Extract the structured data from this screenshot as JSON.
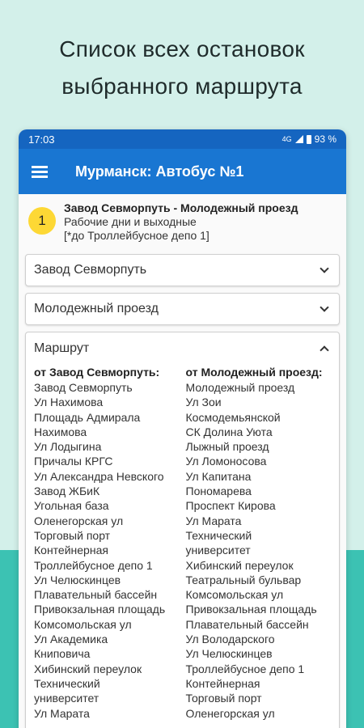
{
  "promo": {
    "line1": "Список всех остановок",
    "line2": "выбранного маршрута"
  },
  "status": {
    "time": "17:03",
    "network": "4G",
    "battery": "93 %"
  },
  "appbar": {
    "title": "Мурманск: Автобус №1"
  },
  "route": {
    "number": "1",
    "name": "Завод Севморпуть - Молодежный проезд",
    "schedule": "Рабочие дни и выходные",
    "note": "[*до Троллейбусное депо 1]"
  },
  "selects": {
    "from": "Завод Севморпуть",
    "to": "Молодежный проезд"
  },
  "panel": {
    "title": "Маршрут",
    "left_header": "от Завод Севморпуть:",
    "right_header": "от Молодежный проезд:",
    "left_stops": [
      "Завод Севморпуть",
      "Ул Нахимова",
      "Площадь Адмирала",
      "Нахимова",
      "Ул Лодыгина",
      "Причалы КРГС",
      "Ул Александра Невского",
      "Завод ЖБиК",
      "Угольная база",
      "Оленегорская ул",
      "Торговый порт",
      "Контейнерная",
      "Троллейбусное депо 1",
      "Ул Челюскинцев",
      "Плавательный бассейн",
      "Привокзальная площадь",
      "Комсомольская ул",
      "Ул Академика",
      "Книповича",
      "Хибинский переулок",
      "Технический",
      "университет",
      "Ул Марата"
    ],
    "right_stops": [
      "Молодежный проезд",
      "Ул Зои",
      "Космодемьянской",
      "СК Долина Уюта",
      "Лыжный проезд",
      "Ул Ломоносова",
      "Ул Капитана",
      "Пономарева",
      "Проспект Кирова",
      "Ул Марата",
      "Технический",
      "университет",
      "Хибинский переулок",
      "Театральный бульвар",
      "Комсомольская ул",
      "Привокзальная площадь",
      "Плавательный бассейн",
      "Ул Володарского",
      "Ул Челюскинцев",
      "Троллейбусное депо 1",
      "Контейнерная",
      "Торговый порт",
      "Оленегорская ул"
    ]
  },
  "colors": {
    "statusbar": "#1565c0",
    "appbar": "#1976d2",
    "badge": "#fdd835",
    "bg_light": "#d3f0ea",
    "bg_teal": "#3cc2b3"
  }
}
